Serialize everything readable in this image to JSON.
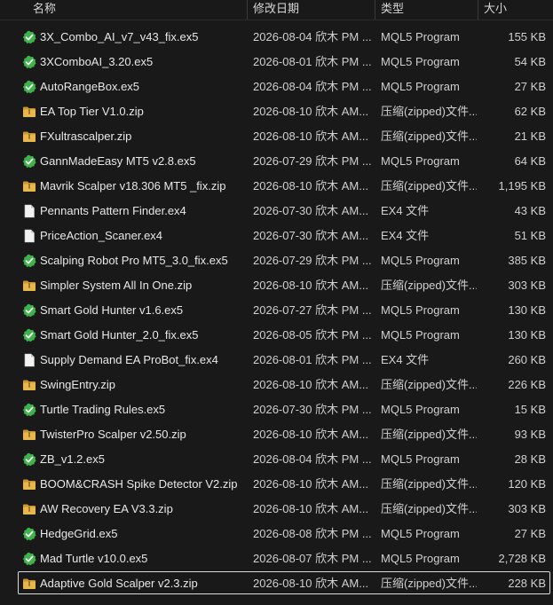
{
  "columns": {
    "name": "名称",
    "date": "修改日期",
    "type": "类型",
    "size": "大小"
  },
  "icon_colors": {
    "mql5": "#3cb44a",
    "zip": "#e8b64a",
    "ex4": "#f2f2f2"
  },
  "files": [
    {
      "name": "3X_Combo_AI_v7_v43_fix.ex5",
      "date": "2026-08-04 欣木 PM ...",
      "type": "MQL5 Program",
      "size": "155 KB",
      "icon": "mql5-program-icon"
    },
    {
      "name": "3XComboAI_3.20.ex5",
      "date": "2026-08-01 欣木 PM ...",
      "type": "MQL5 Program",
      "size": "54 KB",
      "icon": "mql5-program-icon"
    },
    {
      "name": "AutoRangeBox.ex5",
      "date": "2026-08-04 欣木 PM ...",
      "type": "MQL5 Program",
      "size": "27 KB",
      "icon": "mql5-program-icon"
    },
    {
      "name": "EA Top Tier V1.0.zip",
      "date": "2026-08-10 欣木 AM...",
      "type": "压缩(zipped)文件...",
      "size": "62 KB",
      "icon": "zip-folder-icon"
    },
    {
      "name": "FXultrascalper.zip",
      "date": "2026-08-10 欣木 AM...",
      "type": "压缩(zipped)文件...",
      "size": "21 KB",
      "icon": "zip-folder-icon"
    },
    {
      "name": "GannMadeEasy MT5 v2.8.ex5",
      "date": "2026-07-29 欣木 PM ...",
      "type": "MQL5 Program",
      "size": "64 KB",
      "icon": "mql5-program-icon"
    },
    {
      "name": "Mavrik Scalper v18.306 MT5 _fix.zip",
      "date": "2026-08-10 欣木 AM...",
      "type": "压缩(zipped)文件...",
      "size": "1,195 KB",
      "icon": "zip-folder-icon"
    },
    {
      "name": "Pennants Pattern Finder.ex4",
      "date": "2026-07-30 欣木 AM...",
      "type": "EX4 文件",
      "size": "43 KB",
      "icon": "file-icon"
    },
    {
      "name": "PriceAction_Scaner.ex4",
      "date": "2026-07-30 欣木 AM...",
      "type": "EX4 文件",
      "size": "51 KB",
      "icon": "file-icon"
    },
    {
      "name": "Scalping Robot Pro MT5_3.0_fix.ex5",
      "date": "2026-07-29 欣木 PM ...",
      "type": "MQL5 Program",
      "size": "385 KB",
      "icon": "mql5-program-icon"
    },
    {
      "name": "Simpler System All In One.zip",
      "date": "2026-08-10 欣木 AM...",
      "type": "压缩(zipped)文件...",
      "size": "303 KB",
      "icon": "zip-folder-icon"
    },
    {
      "name": "Smart Gold Hunter v1.6.ex5",
      "date": "2026-07-27 欣木 PM ...",
      "type": "MQL5 Program",
      "size": "130 KB",
      "icon": "mql5-program-icon"
    },
    {
      "name": "Smart Gold Hunter_2.0_fix.ex5",
      "date": "2026-08-05 欣木 PM ...",
      "type": "MQL5 Program",
      "size": "130 KB",
      "icon": "mql5-program-icon"
    },
    {
      "name": "Supply Demand EA ProBot_fix.ex4",
      "date": "2026-08-01 欣木 PM ...",
      "type": "EX4 文件",
      "size": "260 KB",
      "icon": "file-icon"
    },
    {
      "name": "SwingEntry.zip",
      "date": "2026-08-10 欣木 AM...",
      "type": "压缩(zipped)文件...",
      "size": "226 KB",
      "icon": "zip-folder-icon"
    },
    {
      "name": "Turtle Trading Rules.ex5",
      "date": "2026-07-30 欣木 PM ...",
      "type": "MQL5 Program",
      "size": "15 KB",
      "icon": "mql5-program-icon"
    },
    {
      "name": "TwisterPro Scalper v2.50.zip",
      "date": "2026-08-10 欣木 AM...",
      "type": "压缩(zipped)文件...",
      "size": "93 KB",
      "icon": "zip-folder-icon"
    },
    {
      "name": "ZB_v1.2.ex5",
      "date": "2026-08-04 欣木 PM ...",
      "type": "MQL5 Program",
      "size": "28 KB",
      "icon": "mql5-program-icon"
    },
    {
      "name": "BOOM&CRASH Spike Detector V2.zip",
      "date": "2026-08-10 欣木 AM...",
      "type": "压缩(zipped)文件...",
      "size": "120 KB",
      "icon": "zip-folder-icon"
    },
    {
      "name": "AW Recovery EA V3.3.zip",
      "date": "2026-08-10 欣木 AM...",
      "type": "压缩(zipped)文件...",
      "size": "303 KB",
      "icon": "zip-folder-icon"
    },
    {
      "name": "HedgeGrid.ex5",
      "date": "2026-08-08 欣木 PM ...",
      "type": "MQL5 Program",
      "size": "27 KB",
      "icon": "mql5-program-icon"
    },
    {
      "name": "Mad Turtle v10.0.ex5",
      "date": "2026-08-07 欣木 PM ...",
      "type": "MQL5 Program",
      "size": "2,728 KB",
      "icon": "mql5-program-icon"
    },
    {
      "name": "Adaptive Gold Scalper v2.3.zip",
      "date": "2026-08-10 欣木 AM...",
      "type": "压缩(zipped)文件...",
      "size": "228 KB",
      "icon": "zip-folder-icon",
      "selected": true
    }
  ]
}
